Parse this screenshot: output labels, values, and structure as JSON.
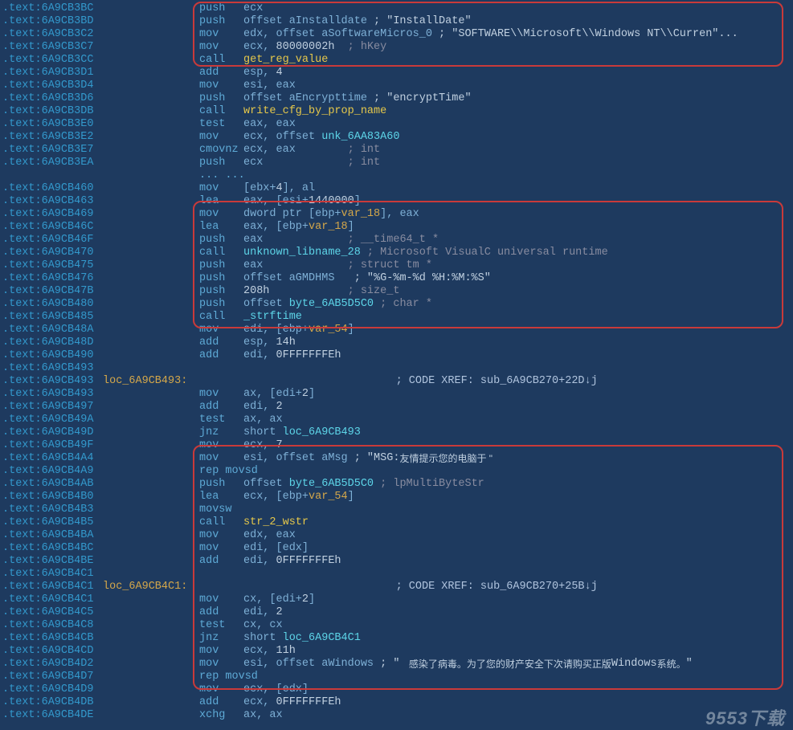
{
  "watermark": "9553下载",
  "lines": [
    {
      "addr": ".text:6A9CB3BC",
      "mnem": "push",
      "op": [
        {
          "t": "ecx",
          "c": "op"
        }
      ]
    },
    {
      "addr": ".text:6A9CB3BD",
      "mnem": "push",
      "op": [
        {
          "t": "offset aInstalldate ",
          "c": "op"
        },
        {
          "t": "; \"InstallDate\"",
          "c": "str"
        }
      ]
    },
    {
      "addr": ".text:6A9CB3C2",
      "mnem": "mov",
      "op": [
        {
          "t": "edx, offset aSoftwareMicros_0 ",
          "c": "op"
        },
        {
          "t": "; \"SOFTWARE\\\\Microsoft\\\\Windows NT\\\\Curren\"...",
          "c": "str"
        }
      ]
    },
    {
      "addr": ".text:6A9CB3C7",
      "mnem": "mov",
      "op": [
        {
          "t": "ecx, ",
          "c": "op"
        },
        {
          "t": "80000002h",
          "c": "num"
        },
        {
          "t": "  ; hKey",
          "c": "cmt"
        }
      ]
    },
    {
      "addr": ".text:6A9CB3CC",
      "mnem": "call",
      "op": [
        {
          "t": "get_reg_value",
          "c": "func-yellow"
        }
      ]
    },
    {
      "addr": ".text:6A9CB3D1",
      "mnem": "add",
      "op": [
        {
          "t": "esp, ",
          "c": "op"
        },
        {
          "t": "4",
          "c": "num"
        }
      ]
    },
    {
      "addr": ".text:6A9CB3D4",
      "mnem": "mov",
      "op": [
        {
          "t": "esi, eax",
          "c": "op"
        }
      ]
    },
    {
      "addr": ".text:6A9CB3D6",
      "mnem": "push",
      "op": [
        {
          "t": "offset aEncrypttime ",
          "c": "op"
        },
        {
          "t": "; \"encryptTime\"",
          "c": "str"
        }
      ]
    },
    {
      "addr": ".text:6A9CB3DB",
      "mnem": "call",
      "op": [
        {
          "t": "write_cfg_by_prop_name",
          "c": "func-yellow"
        }
      ]
    },
    {
      "addr": ".text:6A9CB3E0",
      "mnem": "test",
      "op": [
        {
          "t": "eax, eax",
          "c": "op"
        }
      ]
    },
    {
      "addr": ".text:6A9CB3E2",
      "mnem": "mov",
      "op": [
        {
          "t": "ecx, offset ",
          "c": "op"
        },
        {
          "t": "unk_6AA83A60",
          "c": "func-cyan"
        }
      ]
    },
    {
      "addr": ".text:6A9CB3E7",
      "mnem": "cmovnz",
      "op": [
        {
          "t": "ecx, eax",
          "c": "op"
        },
        {
          "t": "        ; int",
          "c": "cmt"
        }
      ]
    },
    {
      "addr": ".text:6A9CB3EA",
      "mnem": "push",
      "op": [
        {
          "t": "ecx",
          "c": "op"
        },
        {
          "t": "             ; int",
          "c": "cmt"
        }
      ]
    },
    {
      "addr": "",
      "blank": true
    },
    {
      "addr": "",
      "dots": "... ..."
    },
    {
      "addr": ".text:6A9CB460",
      "mnem": "mov",
      "op": [
        {
          "t": "[ebx+",
          "c": "op"
        },
        {
          "t": "4",
          "c": "num"
        },
        {
          "t": "], al",
          "c": "op"
        }
      ]
    },
    {
      "addr": ".text:6A9CB463",
      "mnem": "lea",
      "op": [
        {
          "t": "eax, [esi+",
          "c": "op"
        },
        {
          "t": "1440000",
          "c": "num"
        },
        {
          "t": "]",
          "c": "op"
        }
      ]
    },
    {
      "addr": ".text:6A9CB469",
      "mnem": "mov",
      "op": [
        {
          "t": "dword ptr [ebp+",
          "c": "op"
        },
        {
          "t": "var_18",
          "c": "reg-var"
        },
        {
          "t": "], eax",
          "c": "op"
        }
      ]
    },
    {
      "addr": ".text:6A9CB46C",
      "mnem": "lea",
      "op": [
        {
          "t": "eax, [ebp+",
          "c": "op"
        },
        {
          "t": "var_18",
          "c": "reg-var"
        },
        {
          "t": "]",
          "c": "op"
        }
      ]
    },
    {
      "addr": ".text:6A9CB46F",
      "mnem": "push",
      "op": [
        {
          "t": "eax",
          "c": "op"
        },
        {
          "t": "             ; __time64_t *",
          "c": "cmt"
        }
      ]
    },
    {
      "addr": ".text:6A9CB470",
      "mnem": "call",
      "op": [
        {
          "t": "unknown_libname_28",
          "c": "func-cyan"
        },
        {
          "t": " ; Microsoft VisualC universal runtime",
          "c": "cmt"
        }
      ]
    },
    {
      "addr": ".text:6A9CB475",
      "mnem": "push",
      "op": [
        {
          "t": "eax",
          "c": "op"
        },
        {
          "t": "             ; struct tm *",
          "c": "cmt"
        }
      ]
    },
    {
      "addr": ".text:6A9CB476",
      "mnem": "push",
      "op": [
        {
          "t": "offset aGMDHMS   ",
          "c": "op"
        },
        {
          "t": "; \"%G-%m-%d %H:%M:%S\"",
          "c": "str"
        }
      ]
    },
    {
      "addr": ".text:6A9CB47B",
      "mnem": "push",
      "op": [
        {
          "t": "208h",
          "c": "num"
        },
        {
          "t": "            ; size_t",
          "c": "cmt"
        }
      ]
    },
    {
      "addr": ".text:6A9CB480",
      "mnem": "push",
      "op": [
        {
          "t": "offset ",
          "c": "op"
        },
        {
          "t": "byte_6AB5D5C0",
          "c": "func-cyan"
        },
        {
          "t": " ; char *",
          "c": "cmt"
        }
      ]
    },
    {
      "addr": ".text:6A9CB485",
      "mnem": "call",
      "op": [
        {
          "t": "_strftime",
          "c": "func-cyan"
        }
      ]
    },
    {
      "addr": ".text:6A9CB48A",
      "mnem": "mov",
      "op": [
        {
          "t": "edi, [ebp+",
          "c": "op"
        },
        {
          "t": "var_54",
          "c": "reg-var"
        },
        {
          "t": "]",
          "c": "op"
        }
      ]
    },
    {
      "addr": ".text:6A9CB48D",
      "mnem": "add",
      "op": [
        {
          "t": "esp, ",
          "c": "op"
        },
        {
          "t": "14h",
          "c": "num"
        }
      ]
    },
    {
      "addr": ".text:6A9CB490",
      "mnem": "add",
      "op": [
        {
          "t": "edi, ",
          "c": "op"
        },
        {
          "t": "0FFFFFFFEh",
          "c": "num"
        }
      ]
    },
    {
      "addr": ".text:6A9CB493",
      "mnem": "",
      "op": []
    },
    {
      "addr": ".text:6A9CB493",
      "label": "loc_6A9CB493:",
      "xref": "; CODE XREF: sub_6A9CB270+22D↓j"
    },
    {
      "addr": ".text:6A9CB493",
      "mnem": "mov",
      "op": [
        {
          "t": "ax, [edi+",
          "c": "op"
        },
        {
          "t": "2",
          "c": "num"
        },
        {
          "t": "]",
          "c": "op"
        }
      ]
    },
    {
      "addr": ".text:6A9CB497",
      "mnem": "add",
      "op": [
        {
          "t": "edi, ",
          "c": "op"
        },
        {
          "t": "2",
          "c": "num"
        }
      ]
    },
    {
      "addr": ".text:6A9CB49A",
      "mnem": "test",
      "op": [
        {
          "t": "ax, ax",
          "c": "op"
        }
      ]
    },
    {
      "addr": ".text:6A9CB49D",
      "mnem": "jnz",
      "op": [
        {
          "t": "short ",
          "c": "op"
        },
        {
          "t": "loc_6A9CB493",
          "c": "func-cyan"
        }
      ]
    },
    {
      "addr": ".text:6A9CB49F",
      "mnem": "mov",
      "op": [
        {
          "t": "ecx, ",
          "c": "op"
        },
        {
          "t": "7",
          "c": "num"
        }
      ]
    },
    {
      "addr": ".text:6A9CB4A4",
      "mnem": "mov",
      "op": [
        {
          "t": "esi, offset aMsg ",
          "c": "op"
        },
        {
          "t": "; \"MSG:",
          "c": "str"
        },
        {
          "t": "友情提示您的电脑于 \"",
          "c": "str cjk"
        }
      ]
    },
    {
      "addr": ".text:6A9CB4A9",
      "mnem": "rep movsd",
      "op": []
    },
    {
      "addr": ".text:6A9CB4AB",
      "mnem": "push",
      "op": [
        {
          "t": "offset ",
          "c": "op"
        },
        {
          "t": "byte_6AB5D5C0",
          "c": "func-cyan"
        },
        {
          "t": " ; lpMultiByteStr",
          "c": "cmt"
        }
      ]
    },
    {
      "addr": ".text:6A9CB4B0",
      "mnem": "lea",
      "op": [
        {
          "t": "ecx, [ebp+",
          "c": "op"
        },
        {
          "t": "var_54",
          "c": "reg-var"
        },
        {
          "t": "]",
          "c": "op"
        }
      ]
    },
    {
      "addr": ".text:6A9CB4B3",
      "mnem": "movsw",
      "op": []
    },
    {
      "addr": ".text:6A9CB4B5",
      "mnem": "call",
      "op": [
        {
          "t": "str_2_wstr",
          "c": "func-yellow"
        }
      ]
    },
    {
      "addr": ".text:6A9CB4BA",
      "mnem": "mov",
      "op": [
        {
          "t": "edx, eax",
          "c": "op"
        }
      ]
    },
    {
      "addr": ".text:6A9CB4BC",
      "mnem": "mov",
      "op": [
        {
          "t": "edi, [edx]",
          "c": "op"
        }
      ]
    },
    {
      "addr": ".text:6A9CB4BE",
      "mnem": "add",
      "op": [
        {
          "t": "edi, ",
          "c": "op"
        },
        {
          "t": "0FFFFFFFEh",
          "c": "num"
        }
      ]
    },
    {
      "addr": ".text:6A9CB4C1",
      "mnem": "",
      "op": []
    },
    {
      "addr": ".text:6A9CB4C1",
      "label": "loc_6A9CB4C1:",
      "xref": "; CODE XREF: sub_6A9CB270+25B↓j"
    },
    {
      "addr": ".text:6A9CB4C1",
      "mnem": "mov",
      "op": [
        {
          "t": "cx, [edi+",
          "c": "op"
        },
        {
          "t": "2",
          "c": "num"
        },
        {
          "t": "]",
          "c": "op"
        }
      ]
    },
    {
      "addr": ".text:6A9CB4C5",
      "mnem": "add",
      "op": [
        {
          "t": "edi, ",
          "c": "op"
        },
        {
          "t": "2",
          "c": "num"
        }
      ]
    },
    {
      "addr": ".text:6A9CB4C8",
      "mnem": "test",
      "op": [
        {
          "t": "cx, cx",
          "c": "op"
        }
      ]
    },
    {
      "addr": ".text:6A9CB4CB",
      "mnem": "jnz",
      "op": [
        {
          "t": "short ",
          "c": "op"
        },
        {
          "t": "loc_6A9CB4C1",
          "c": "func-cyan"
        }
      ]
    },
    {
      "addr": ".text:6A9CB4CD",
      "mnem": "mov",
      "op": [
        {
          "t": "ecx, ",
          "c": "op"
        },
        {
          "t": "11h",
          "c": "num"
        }
      ]
    },
    {
      "addr": ".text:6A9CB4D2",
      "mnem": "mov",
      "op": [
        {
          "t": "esi, offset aWindows ",
          "c": "op"
        },
        {
          "t": "; \" ",
          "c": "str"
        },
        {
          "t": " 感染了病毒。为了您的财产安全下次请购买正版",
          "c": "str cjk"
        },
        {
          "t": "Windows",
          "c": "str"
        },
        {
          "t": "系统。",
          "c": "str cjk"
        },
        {
          "t": "\"",
          "c": "str"
        }
      ]
    },
    {
      "addr": ".text:6A9CB4D7",
      "mnem": "rep movsd",
      "op": []
    },
    {
      "addr": ".text:6A9CB4D9",
      "mnem": "mov",
      "op": [
        {
          "t": "ecx, [edx]",
          "c": "op"
        }
      ]
    },
    {
      "addr": ".text:6A9CB4DB",
      "mnem": "add",
      "op": [
        {
          "t": "ecx, ",
          "c": "op"
        },
        {
          "t": "0FFFFFFFEh",
          "c": "num"
        }
      ]
    },
    {
      "addr": ".text:6A9CB4DE",
      "mnem": "xchg",
      "op": [
        {
          "t": "ax, ax",
          "c": "op"
        }
      ]
    }
  ]
}
